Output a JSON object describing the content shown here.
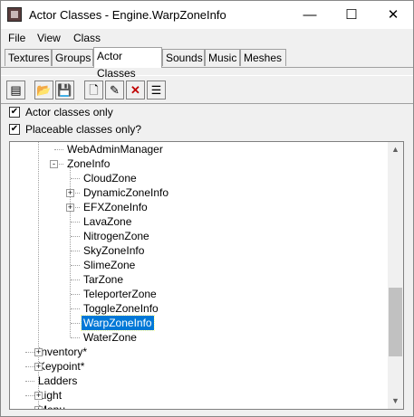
{
  "window": {
    "title": "Actor Classes - Engine.WarpZoneInfo",
    "controls": {
      "minimize": "—",
      "maximize": "☐",
      "close": "✕"
    }
  },
  "menu": [
    "File",
    "View",
    "Class"
  ],
  "tabs": [
    "Textures",
    "Groups",
    "Actor Classes",
    "Sounds",
    "Music",
    "Meshes"
  ],
  "active_tab": "Actor Classes",
  "toolbar": {
    "buttons": [
      "tree-view-icon",
      "open-folder-icon",
      "save-icon",
      "new-document-icon",
      "edit-pencil-icon",
      "delete-x-icon",
      "properties-icon"
    ],
    "glyphs": [
      "▤",
      "📂",
      "💾",
      "🗋",
      "✎",
      "✕",
      "☰"
    ]
  },
  "options": {
    "actor_classes_only": {
      "label": "Actor classes only",
      "checked": true
    },
    "placeable_only": {
      "label": "Placeable classes only?",
      "checked": true
    }
  },
  "tree": {
    "items": [
      {
        "label": "WebAdminManager",
        "level": 1,
        "expander": ""
      },
      {
        "label": "ZoneInfo",
        "level": 1,
        "expander": "-"
      },
      {
        "label": "CloudZone",
        "level": 2,
        "expander": ""
      },
      {
        "label": "DynamicZoneInfo",
        "level": 2,
        "expander": "+"
      },
      {
        "label": "EFXZoneInfo",
        "level": 2,
        "expander": "+"
      },
      {
        "label": "LavaZone",
        "level": 2,
        "expander": ""
      },
      {
        "label": "NitrogenZone",
        "level": 2,
        "expander": ""
      },
      {
        "label": "SkyZoneInfo",
        "level": 2,
        "expander": ""
      },
      {
        "label": "SlimeZone",
        "level": 2,
        "expander": ""
      },
      {
        "label": "TarZone",
        "level": 2,
        "expander": ""
      },
      {
        "label": "TeleporterZone",
        "level": 2,
        "expander": ""
      },
      {
        "label": "ToggleZoneInfo",
        "level": 2,
        "expander": ""
      },
      {
        "label": "WarpZoneInfo",
        "level": 2,
        "expander": "",
        "selected": true
      },
      {
        "label": "WaterZone",
        "level": 2,
        "expander": ""
      },
      {
        "label": "Inventory*",
        "level": 0,
        "expander": "+"
      },
      {
        "label": "Keypoint*",
        "level": 0,
        "expander": "+"
      },
      {
        "label": "Ladders",
        "level": 0,
        "expander": ""
      },
      {
        "label": "Light",
        "level": 0,
        "expander": "+"
      },
      {
        "label": "Menu",
        "level": 0,
        "expander": "+"
      }
    ],
    "scroll_position": 0.72
  },
  "colors": {
    "selection": "#0078d7",
    "background": "#f0f0f0"
  }
}
